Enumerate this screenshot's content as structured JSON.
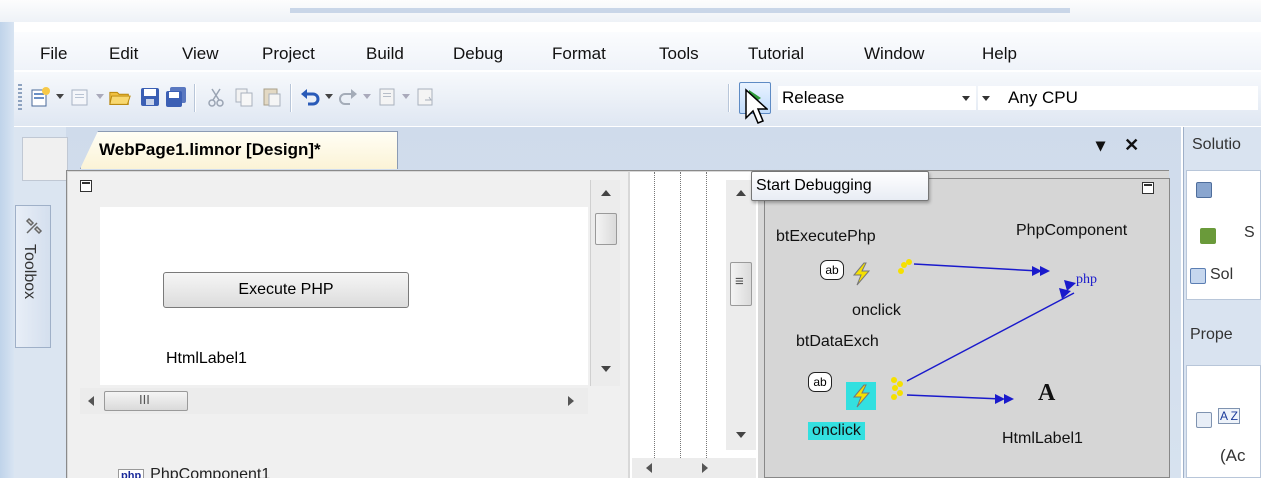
{
  "menubar": {
    "items": [
      "File",
      "Edit",
      "View",
      "Project",
      "Build",
      "Debug",
      "Format",
      "Tools",
      "Tutorial",
      "Window",
      "Help"
    ]
  },
  "toolbar": {
    "configuration": "Release",
    "platform": "Any CPU",
    "start_tooltip": "Start Debugging"
  },
  "document": {
    "tab_title": "WebPage1.limnor [Design]*",
    "close_glyph": "✕",
    "dropdown_glyph": "▾"
  },
  "toolbox": {
    "label": "Toolbox"
  },
  "form": {
    "button_text": "Execute PHP",
    "label_text": "HtmlLabel1",
    "hscroll_grip": "III",
    "vscroll_grip": "≡",
    "component_badge": "php",
    "component_name": "PhpComponent1"
  },
  "event_map": {
    "bt_execute": "btExecutePhp",
    "php_component": "PhpComponent",
    "event1": "onclick",
    "bt_data_exch": "btDataExch",
    "event2": "onclick",
    "php_node": "php",
    "label_node": "A",
    "html_label": "HtmlLabel1",
    "ab_icon": "ab"
  },
  "right_pane": {
    "solution_title": "Solutio",
    "item1": "S",
    "item2": "Sol",
    "properties_title": "Prope",
    "cat_icon": "A Z",
    "prop_row": "(Ac"
  },
  "colors": {
    "accent_blue": "#1a1acc",
    "lightning": "#f5e000",
    "highlight_cyan": "#33e0e0",
    "play_green": "#2f9c3a"
  }
}
